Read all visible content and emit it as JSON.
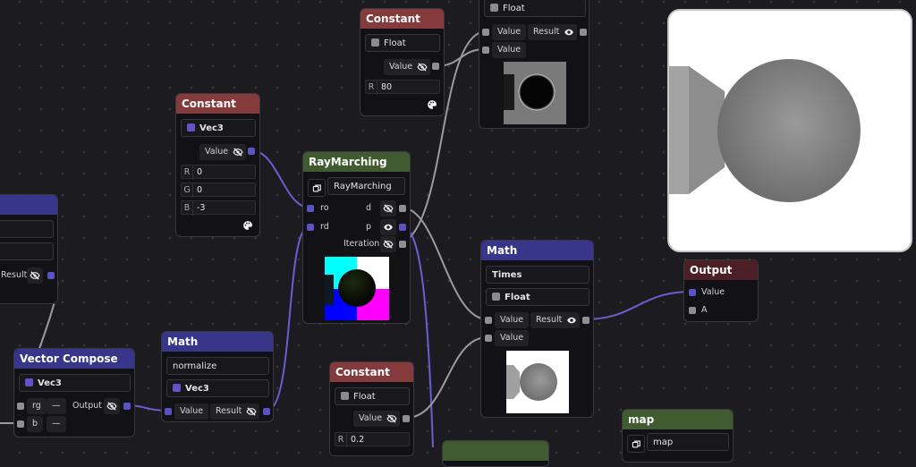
{
  "colors": {
    "bg": "#1c1b1f",
    "constant_header": "#853a3b",
    "math_header": "#37368a",
    "raymarch_header": "#3f5b2f",
    "output_header": "#4c1f27",
    "wire": "#9a9aa0",
    "wire_blue": "#6a5fd0"
  },
  "icons": {
    "hidden": "eye-slash",
    "visible": "eye",
    "palette": "palette",
    "node_swap": "node-swap"
  },
  "nodes": {
    "const_top": {
      "title": "Constant",
      "type": "Float",
      "value_label": "Value",
      "r_label": "R",
      "r_value": "80"
    },
    "float_top": {
      "type": "Float",
      "value1": "Value",
      "value2": "Value",
      "result": "Result"
    },
    "const_vec3": {
      "title": "Constant",
      "type": "Vec3",
      "value_label": "Value",
      "r_label": "R",
      "r_value": "0",
      "g_label": "G",
      "g_value": "0",
      "b_label": "B",
      "b_value": "-3"
    },
    "raymarch": {
      "title": "RayMarching",
      "selector": "RayMarching",
      "in_ro": "ro",
      "in_rd": "rd",
      "out_d": "d",
      "out_p": "p",
      "out_iter": "Iteration"
    },
    "left_partial": {
      "result": "Result"
    },
    "vector_compose": {
      "title": "Vector Compose",
      "type": "Vec3",
      "rg": "rg",
      "b": "b",
      "minus": "—",
      "output": "Output"
    },
    "math_normalize": {
      "title": "Math",
      "op": "normalize",
      "type": "Vec3",
      "value": "Value",
      "result": "Result"
    },
    "const_bottom": {
      "title": "Constant",
      "type": "Float",
      "value_label": "Value",
      "r_label": "R",
      "r_value": "0.2"
    },
    "math_times": {
      "title": "Math",
      "op": "Times",
      "type": "Float",
      "value1": "Value",
      "value2": "Value",
      "result": "Result"
    },
    "output": {
      "title": "Output",
      "value": "Value",
      "a": "A"
    },
    "map": {
      "title": "map",
      "selector": "map"
    }
  }
}
